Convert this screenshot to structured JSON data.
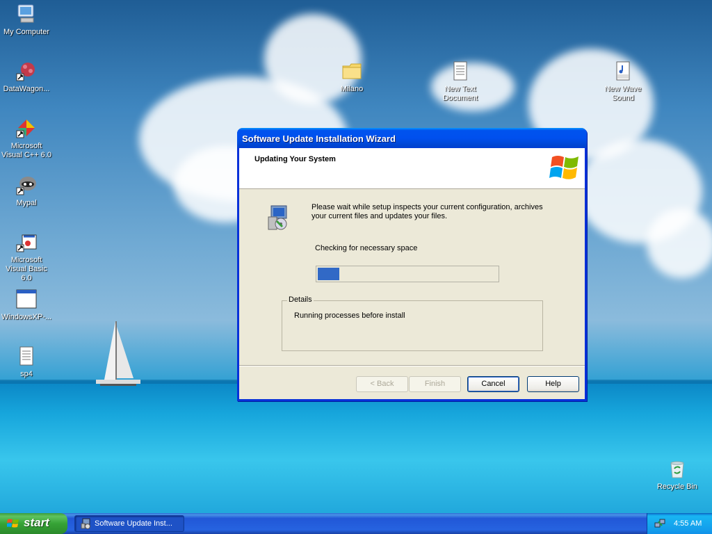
{
  "desktop": {
    "icons": [
      {
        "label": "My Computer"
      },
      {
        "label": "DataWagon..."
      },
      {
        "label": "Microsoft Visual C++ 6.0"
      },
      {
        "label": "Mypal"
      },
      {
        "label": "Microsoft Visual Basic 6.0"
      },
      {
        "label": "WindowsXP-..."
      },
      {
        "label": "sp4"
      },
      {
        "label": "Milano"
      },
      {
        "label": "New Text Document"
      },
      {
        "label": "New Wave Sound"
      },
      {
        "label": "Recycle Bin"
      }
    ]
  },
  "wizard": {
    "title": "Software Update Installation Wizard",
    "header_title": "Updating Your System",
    "intro_text": "Please wait while setup inspects your current configuration, archives your current files and updates your files.",
    "status_text": "Checking for necessary space",
    "progress_percent": 12,
    "details_label": "Details",
    "details_text": "Running processes before install",
    "buttons": {
      "back": "< Back",
      "finish": "Finish",
      "cancel": "Cancel",
      "help": "Help"
    }
  },
  "taskbar": {
    "start_label": "start",
    "task_label": "Software Update Inst...",
    "clock": "4:55 AM"
  },
  "colors": {
    "title_blue": "#0050ee",
    "progress_blue": "#3169c6",
    "start_green": "#36a336"
  }
}
